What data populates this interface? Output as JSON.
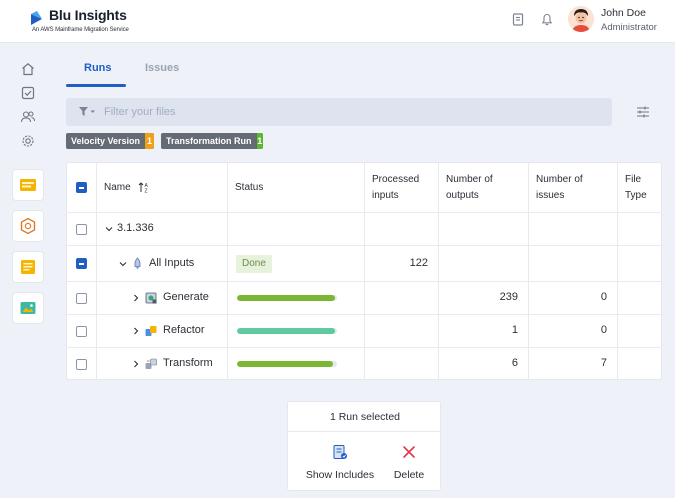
{
  "header": {
    "app_title": "Blu Insights",
    "app_subtitle": "An AWS Mainframe Migration Service",
    "user_name": "John Doe",
    "user_role": "Administrator"
  },
  "tabs": [
    {
      "label": "Runs",
      "active": true
    },
    {
      "label": "Issues",
      "active": false
    }
  ],
  "filter": {
    "placeholder": "Filter your files",
    "value": ""
  },
  "chips": [
    {
      "label": "Velocity Version",
      "count": "1",
      "color": "#f0a11a"
    },
    {
      "label": "Transformation Run",
      "count": "1",
      "color": "#5cb82e"
    }
  ],
  "table": {
    "columns": [
      "Name",
      "Status",
      "Processed inputs",
      "Number of outputs",
      "Number of issues",
      "File Type"
    ],
    "rows": [
      {
        "name": "3.1.336",
        "status": "",
        "processed": "",
        "outputs": "",
        "issues": ""
      },
      {
        "name": "All Inputs",
        "status": "Done",
        "processed": "122",
        "outputs": "",
        "issues": ""
      },
      {
        "name": "Generate",
        "progress": 0.98,
        "progress_color": "#7cb733",
        "processed": "",
        "outputs": "239",
        "issues": "0"
      },
      {
        "name": "Refactor",
        "progress": 0.98,
        "progress_color": "#5fcaa0",
        "processed": "",
        "outputs": "1",
        "issues": "0"
      },
      {
        "name": "Transform",
        "progress": 0.96,
        "progress_color": "#7cb733",
        "processed": "",
        "outputs": "6",
        "issues": "7"
      }
    ]
  },
  "selection_bar": {
    "title": "1 Run selected",
    "show_includes_label": "Show Includes",
    "delete_label": "Delete"
  },
  "colors": {
    "accent": "#1f5fc4",
    "delete": "#e0394a"
  }
}
